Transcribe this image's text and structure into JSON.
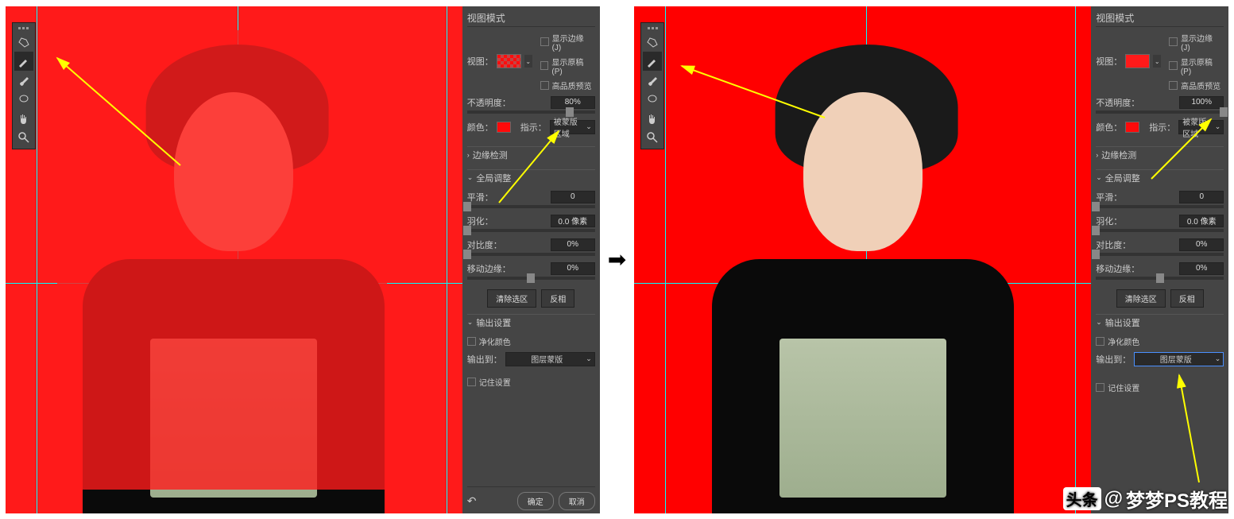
{
  "watermark": {
    "prefix": "头条",
    "at": "@",
    "name": "梦梦PS教程"
  },
  "left": {
    "panel_title": "视图模式",
    "view_label": "视图：",
    "checks": {
      "show_edge": "显示边缘 (J)",
      "show_original": "显示原稿 (P)",
      "high_quality": "高品质预览"
    },
    "opacity": {
      "label": "不透明度：",
      "value": "80%",
      "pos": 80
    },
    "color_label": "颜色：",
    "indicate_label": "指示：",
    "indicate_value": "被蒙版区域",
    "sections": {
      "edge_detect": "边缘检测",
      "global_adjust": "全局调整",
      "output": "输出设置"
    },
    "smooth": {
      "label": "平滑：",
      "value": "0",
      "pos": 0
    },
    "feather": {
      "label": "羽化：",
      "value": "0.0 像素",
      "pos": 0
    },
    "contrast": {
      "label": "对比度：",
      "value": "0%",
      "pos": 0
    },
    "shift": {
      "label": "移动边缘：",
      "value": "0%",
      "pos": 50
    },
    "clear_btn": "清除选区",
    "invert_btn": "反相",
    "decontaminate": "净化颜色",
    "output_to_label": "输出到：",
    "output_to_value": "图层蒙版",
    "remember": "记住设置",
    "ok": "确定",
    "cancel": "取消"
  },
  "right": {
    "panel_title": "视图模式",
    "view_label": "视图：",
    "checks": {
      "show_edge": "显示边缘 (J)",
      "show_original": "显示原稿 (P)",
      "high_quality": "高品质预览"
    },
    "opacity": {
      "label": "不透明度：",
      "value": "100%",
      "pos": 100
    },
    "color_label": "颜色：",
    "indicate_label": "指示：",
    "indicate_value": "被蒙版区域",
    "sections": {
      "edge_detect": "边缘检测",
      "global_adjust": "全局调整",
      "output": "输出设置"
    },
    "smooth": {
      "label": "平滑：",
      "value": "0",
      "pos": 0
    },
    "feather": {
      "label": "羽化：",
      "value": "0.0 像素",
      "pos": 0
    },
    "contrast": {
      "label": "对比度：",
      "value": "0%",
      "pos": 0
    },
    "shift": {
      "label": "移动边缘：",
      "value": "0%",
      "pos": 50
    },
    "clear_btn": "清除选区",
    "invert_btn": "反相",
    "decontaminate": "净化颜色",
    "output_to_label": "输出到：",
    "output_to_value": "图层蒙版",
    "remember": "记住设置"
  }
}
